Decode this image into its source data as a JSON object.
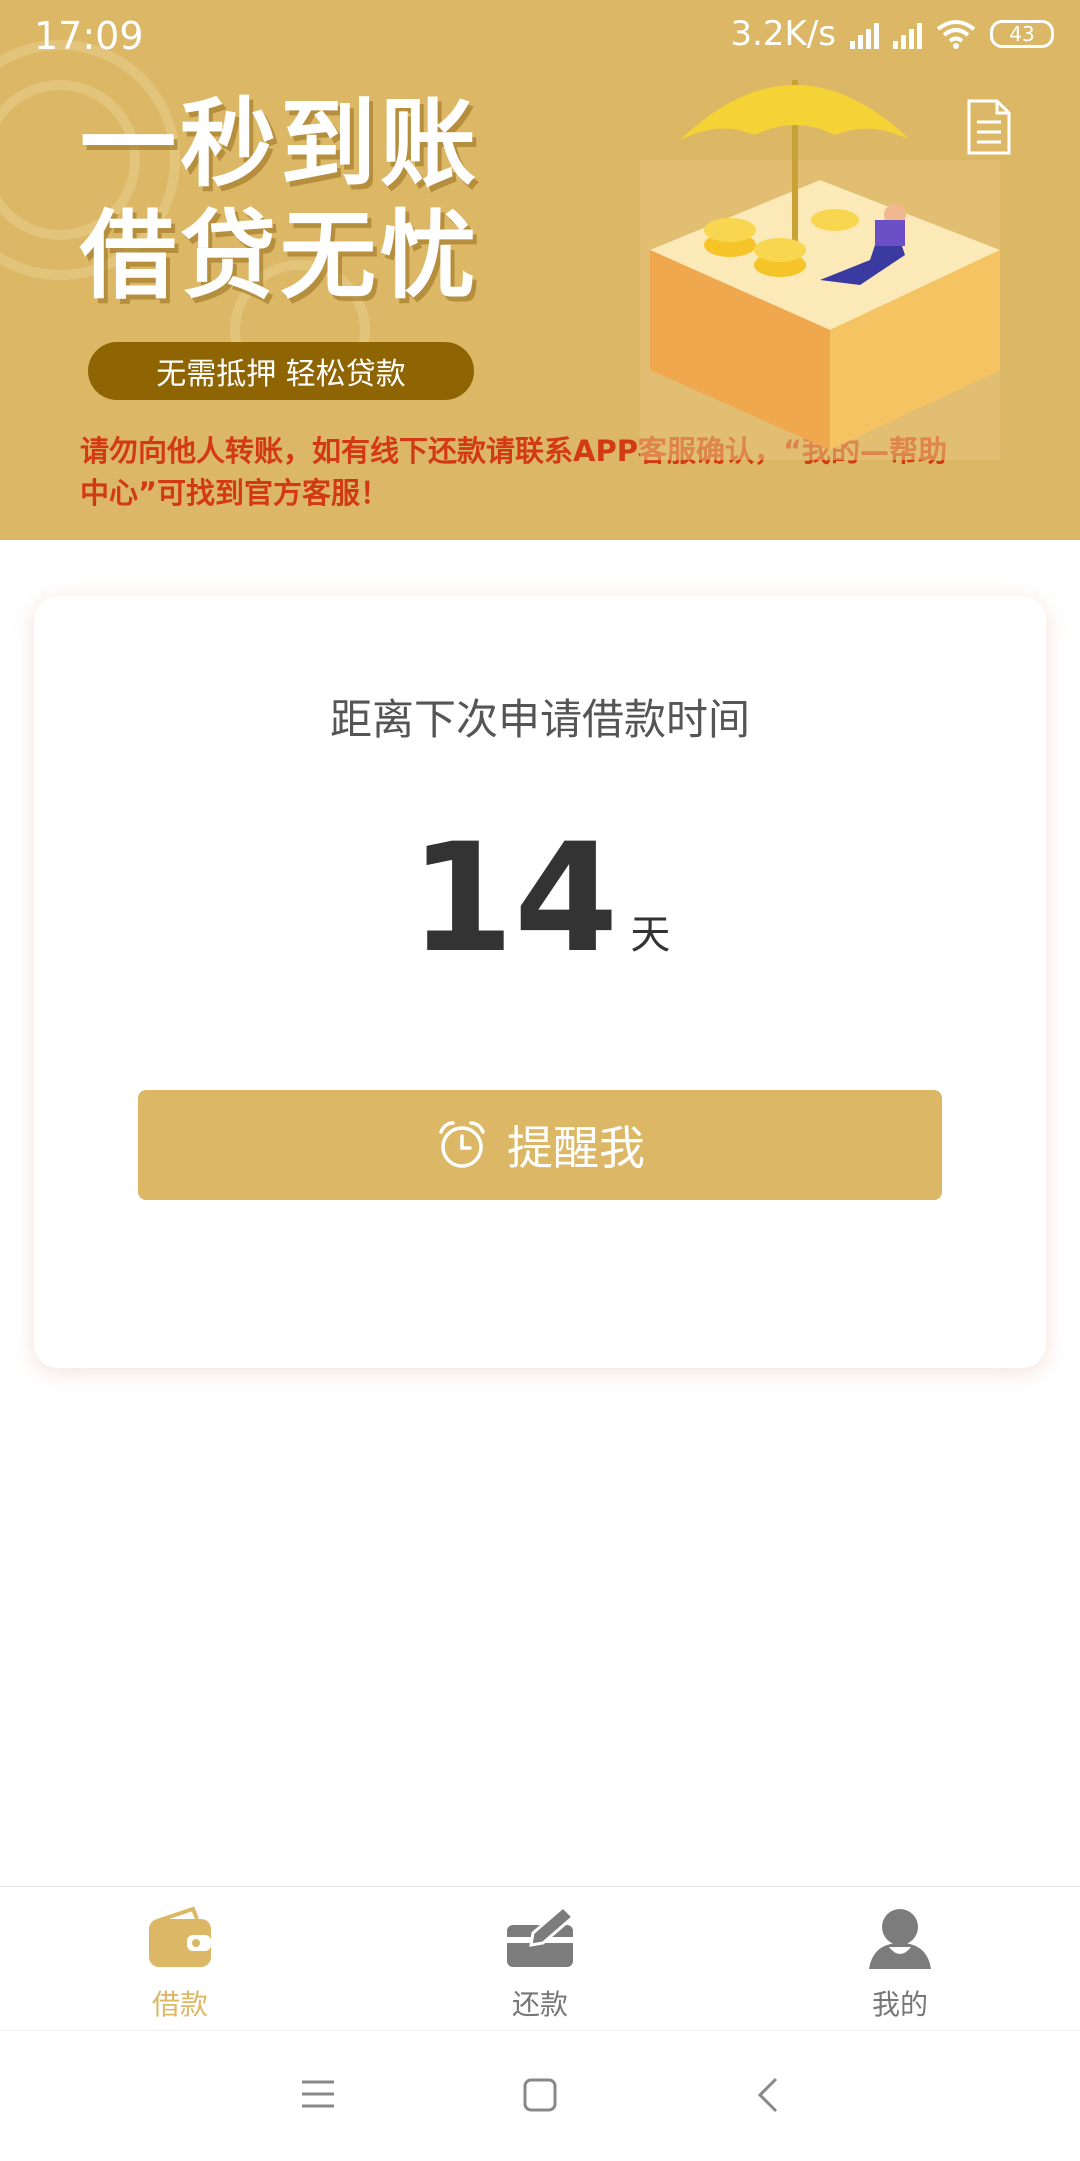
{
  "status": {
    "time": "17:09",
    "speed": "3.2K/s",
    "battery": "43"
  },
  "banner": {
    "headline_line1": "一秒到账",
    "headline_line2": "借贷无忧",
    "pill": "无需抵押  轻松贷款",
    "warning": "请勿向他人转账，如有线下还款请联系APP客服确认，“我的—帮助中心”可找到官方客服！"
  },
  "card": {
    "label": "距离下次申请借款时间",
    "days": "14",
    "unit": "天",
    "remind_button": "提醒我"
  },
  "tabbar": {
    "items": [
      {
        "label": "借款",
        "icon": "wallet-icon",
        "active": true
      },
      {
        "label": "还款",
        "icon": "repay-card-icon",
        "active": false
      },
      {
        "label": "我的",
        "icon": "user-icon",
        "active": false
      }
    ]
  },
  "colors": {
    "accent": "#dcb866",
    "inactive": "#777777",
    "warning": "#d33a14"
  }
}
